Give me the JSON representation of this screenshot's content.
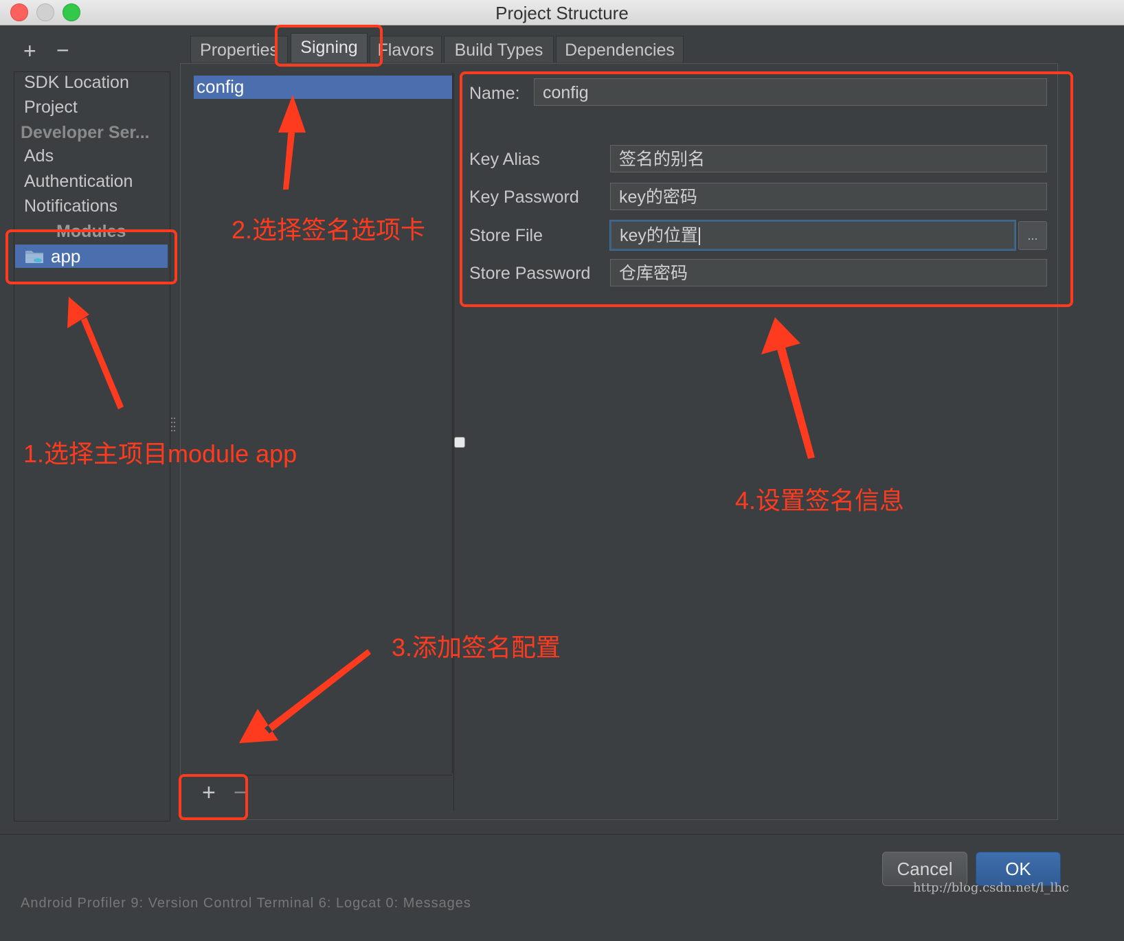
{
  "window": {
    "title": "Project Structure",
    "traffic_lights": [
      "#fc615d",
      "#c8c8c8",
      "#34c84a"
    ]
  },
  "sidebar": {
    "add_glyph": "+",
    "remove_glyph": "−",
    "items": [
      {
        "label": "SDK Location"
      },
      {
        "label": "Project"
      },
      {
        "label": "Developer Ser..."
      },
      {
        "label": "Ads"
      },
      {
        "label": "Authentication"
      },
      {
        "label": "Notifications"
      },
      {
        "label": "Modules"
      },
      {
        "label": "app"
      }
    ]
  },
  "tabs": [
    {
      "label": "Properties"
    },
    {
      "label": "Signing"
    },
    {
      "label": "Flavors"
    },
    {
      "label": "Build Types"
    },
    {
      "label": "Dependencies"
    }
  ],
  "signing_list": {
    "items": [
      {
        "label": "config"
      }
    ],
    "add_glyph": "+",
    "remove_glyph": "−"
  },
  "form": {
    "name_label": "Name:",
    "name_value": "config",
    "fields": [
      {
        "label": "Key Alias",
        "value": "签名的别名"
      },
      {
        "label": "Key Password",
        "value": "key的密码"
      },
      {
        "label": "Store File",
        "value": "key的位置"
      },
      {
        "label": "Store Password",
        "value": "仓库密码"
      }
    ],
    "browse_glyph": "..."
  },
  "buttons": {
    "cancel": "Cancel",
    "ok": "OK"
  },
  "watermark": "http://blog.csdn.net/l_lhc",
  "status_strip_text": "Android Profiler    9: Version Control    Terminal    6: Logcat    0: Messages",
  "annotations": {
    "color": "#ff3b1f",
    "step1": "1.选择主项目module app",
    "step2": "2.选择签名选项卡",
    "step3": "3.添加签名配置",
    "step4": "4.设置签名信息"
  },
  "colors": {
    "selection": "#4b6eaf",
    "background": "#3c3f41",
    "ok_button": "#3e6fae"
  }
}
